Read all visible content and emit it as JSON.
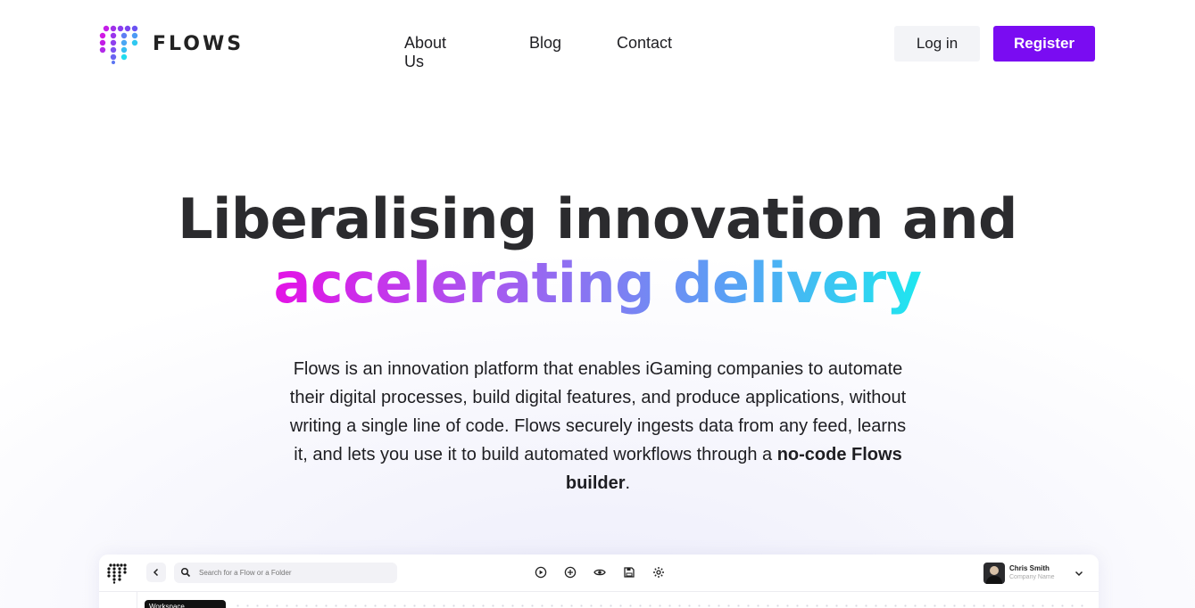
{
  "brand": {
    "name": "FLOWS",
    "colors": {
      "accent": "#7a0cf2",
      "gradient": [
        "#e412e6",
        "#a45cf0",
        "#5aa0f5",
        "#1ee7ef"
      ]
    }
  },
  "nav": {
    "items": [
      "About Us",
      "Blog",
      "Contact"
    ]
  },
  "auth": {
    "login_label": "Log in",
    "register_label": "Register"
  },
  "hero": {
    "title_line1": "Liberalising innovation and",
    "title_line2": "accelerating delivery",
    "subtitle_main": "Flows is an innovation platform that enables iGaming companies to automate their digital processes, build digital features, and produce applications, without writing a single line of code. Flows securely ingests data from any feed, learns it, and lets you use it to build automated workflows through a ",
    "subtitle_bold": "no-code Flows builder",
    "subtitle_end": "."
  },
  "preview": {
    "back_icon": "chevron-left-icon",
    "search_placeholder": "Search for a Flow or a Folder",
    "tools": [
      "play-icon",
      "add-icon",
      "eye-icon",
      "save-icon",
      "settings-icon"
    ],
    "user_name": "Chris Smith",
    "company_name": "Company Name",
    "workspace_label": "Workspace"
  }
}
